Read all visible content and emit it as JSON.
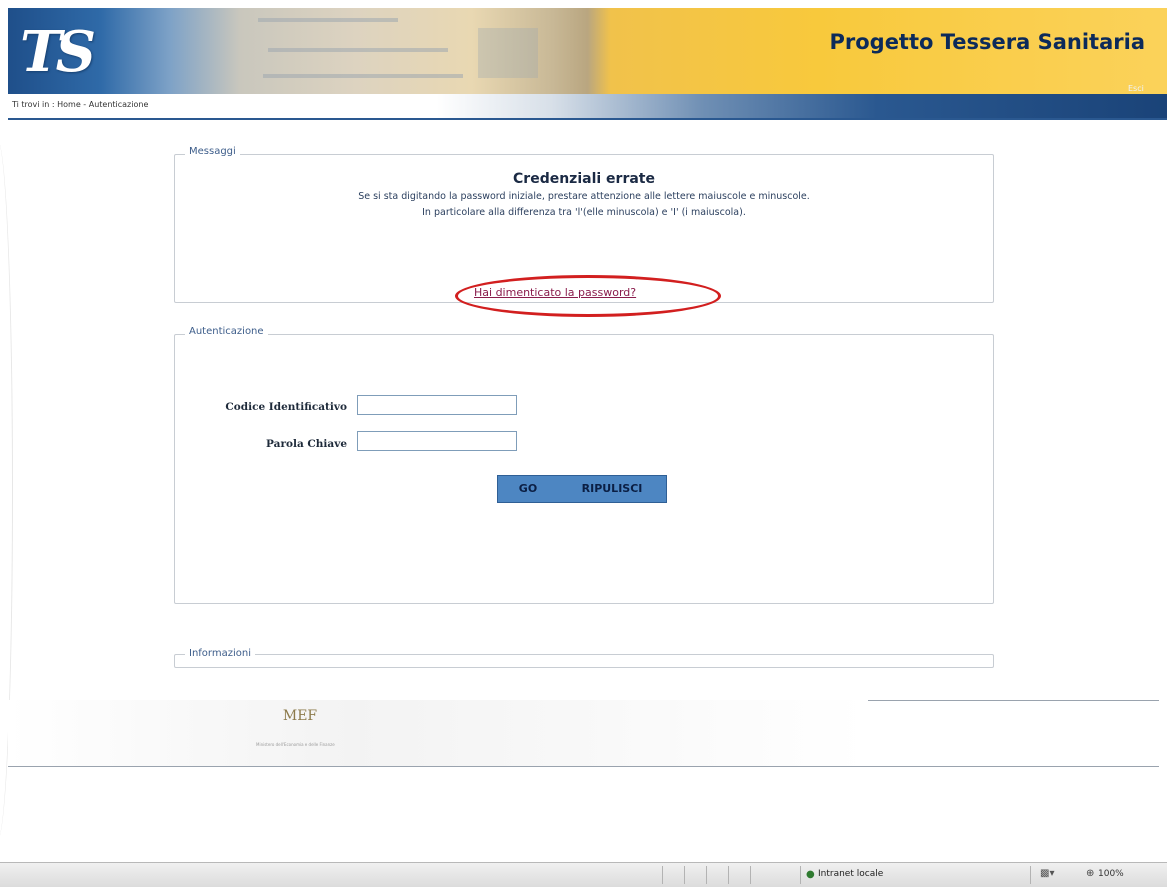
{
  "header": {
    "logo_text": "TS",
    "title": "Progetto Tessera Sanitaria"
  },
  "navbar": {
    "breadcrumb": "Ti trovi in : Home - Autenticazione",
    "exit_label": "Esci"
  },
  "message_panel": {
    "legend": "Messaggi",
    "title": "Credenziali errate",
    "line1": "Se si sta digitando la password iniziale, prestare attenzione alle lettere maiuscole e minuscole.",
    "line2": "In particolare alla differenza tra 'l'(elle minuscola) e 'I' (i maiuscola).",
    "forgot_link": "Hai dimenticato la password?"
  },
  "auth_panel": {
    "legend": "Autenticazione",
    "user_label": "Codice Identificativo",
    "user_value": "",
    "password_label": "Parola Chiave",
    "password_value": "",
    "go_button": "GO",
    "reset_button": "RIPULISCI"
  },
  "info_panel": {
    "legend": "Informazioni"
  },
  "footer": {
    "logo": "MEF",
    "subtitle": "Ministero dell'Economia e delle Finanze"
  },
  "statusbar": {
    "zone": "Intranet locale",
    "zoom": "100%"
  }
}
